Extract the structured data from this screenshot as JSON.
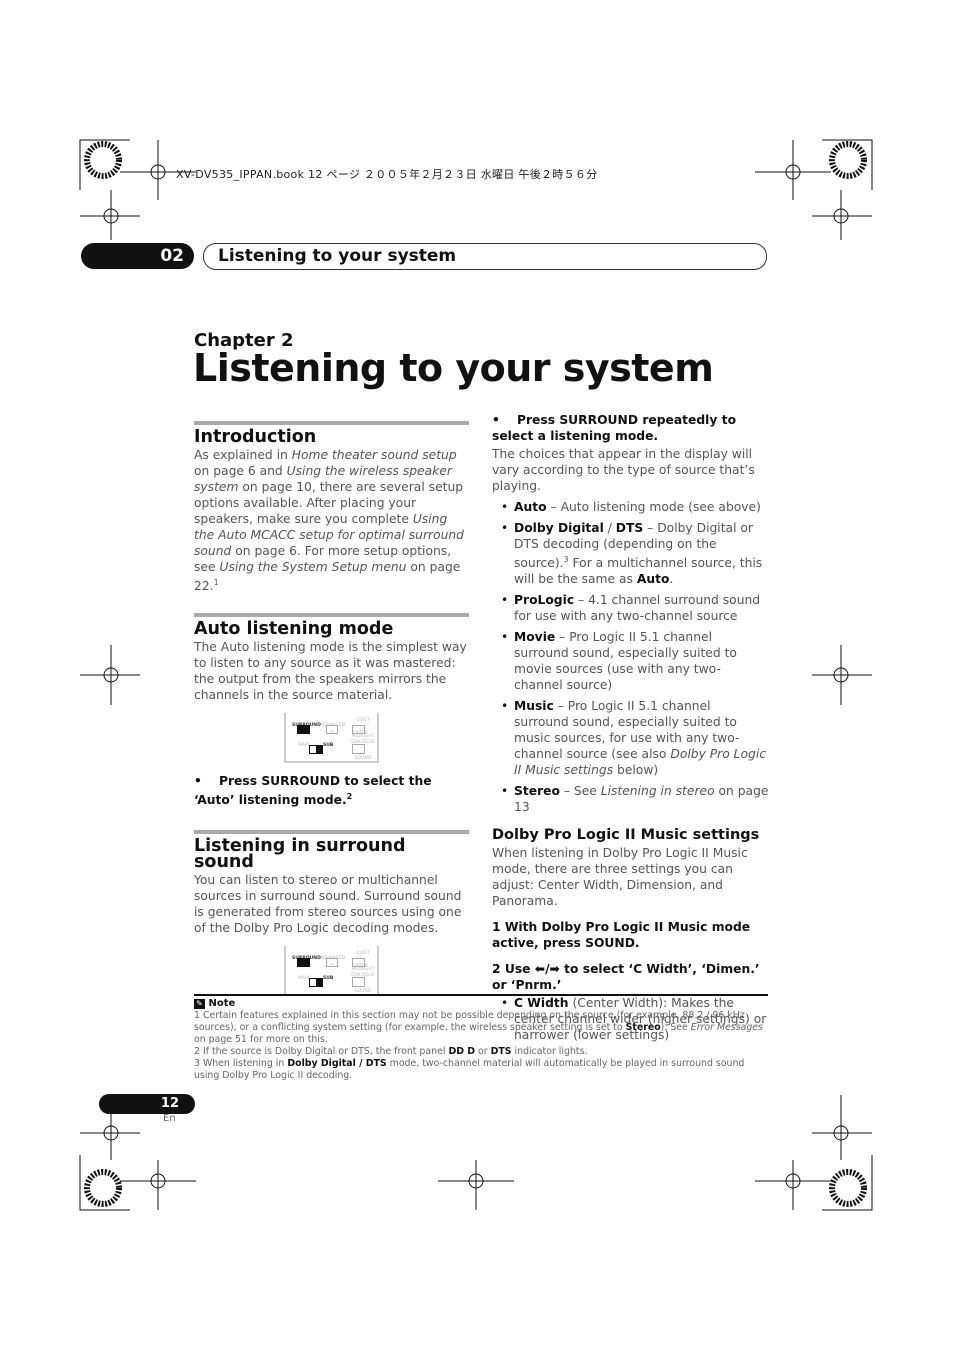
{
  "print_header": "XV-DV535_IPPAN.book  12 ページ  ２００５年２月２３日  水曜日  午後２時５６分",
  "tab": {
    "number": "02",
    "title": "Listening to your system"
  },
  "chapter": {
    "label": "Chapter 2",
    "title": "Listening to your system"
  },
  "intro": {
    "heading": "Introduction",
    "p": [
      "As explained in ",
      "Home theater sound setup",
      " on page 6 and ",
      "Using the wireless speaker system",
      " on page 10, there are several setup options available. After placing your speakers, make sure you complete ",
      "Using the Auto MCACC setup for optimal surround sound",
      " on page 6. For more setup options, see ",
      "Using the System Setup menu",
      " on page 22.",
      "1"
    ]
  },
  "auto": {
    "heading": "Auto listening mode",
    "p": "The Auto listening mode is the simplest way to listen to any source as it was mastered: the output from the speakers mirrors the channels in the source material.",
    "step": "Press SURROUND to select the ‘Auto’ listening mode.",
    "step_sup": "2"
  },
  "remote": {
    "surround": "SURROUND",
    "advanced": "ADVANCED",
    "midnight": "QUIET MIDNIGHT",
    "d": "D",
    "enter": "ENTER",
    "main": "MAIN",
    "sub": "SUB",
    "dialogue": "DIALOGUE SOUND"
  },
  "surround": {
    "heading": "Listening in surround sound",
    "p": "You can listen to stereo or multichannel sources in surround sound. Surround sound is generated from stereo sources using one of the Dolby Pro Logic decoding modes."
  },
  "right": {
    "step": "Press SURROUND repeatedly to select a listening mode.",
    "p": "The choices that appear in the display will vary according to the type of source that’s playing.",
    "modes": [
      {
        "name": "Auto",
        "text": " – Auto listening mode (see above)"
      },
      {
        "name": "Dolby Digital",
        "sep": " / ",
        "name2": "DTS",
        "text": " – Dolby Digital or DTS decoding (depending on the source).",
        "sup": "3",
        "text2": " For a multichannel source, this will be the same as ",
        "b2": "Auto",
        "end": "."
      },
      {
        "name": "ProLogic",
        "text": " – 4.1 channel surround sound for use with any two-channel source"
      },
      {
        "name": "Movie",
        "text": " – Pro Logic II 5.1 channel surround sound, especially suited to movie sources (use with any two-channel source)"
      },
      {
        "name": "Music",
        "text": " – Pro Logic II 5.1 channel surround sound, especially suited to music sources, for use with any two-channel source (see also ",
        "i": "Dolby Pro Logic II Music settings",
        "end": " below)"
      },
      {
        "name": "Stereo",
        "text": " – See ",
        "i": "Listening in stereo",
        "end": " on page 13"
      }
    ],
    "plii_heading": "Dolby Pro Logic II Music settings",
    "plii_p": "When listening in Dolby Pro Logic II Music mode, there are three settings you can adjust: Center Width, Dimension, and Panorama.",
    "step1": "1   With Dolby Pro Logic II Music mode active, press SOUND.",
    "step2": "2   Use ⬅/➡ to select ‘C Width’, ‘Dimen.’ or ‘Pnrm.’",
    "cwidth": {
      "name": "C Width",
      "text": " (Center Width): Makes the center channel wider (higher settings) or narrower (lower settings)"
    }
  },
  "notes": {
    "heading": "Note",
    "n1": [
      "1 Certain features explained in this section may not be possible depending on the source (for example, 88.2 / 96 kHz sources), or a conflicting system setting (for example, the wireless speaker setting is set to ",
      "Stereo",
      "). See ",
      "Error Messages",
      " on page 51 for more on this."
    ],
    "n2": [
      "2 If the source is Dolby Digital or DTS, the front panel ",
      "DD D",
      " or ",
      "DTS",
      " indicator lights."
    ],
    "n3": [
      "3 When listening in ",
      "Dolby Digital / DTS",
      " mode, two-channel material will automatically be played in surround sound using Dolby Pro Logic II decoding."
    ]
  },
  "page": {
    "number": "12",
    "lang": "En"
  }
}
